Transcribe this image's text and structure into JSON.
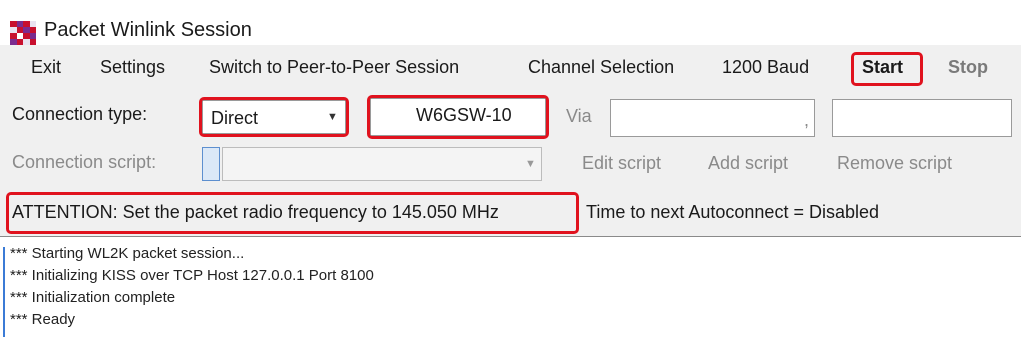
{
  "window": {
    "title": "Packet Winlink Session",
    "icon": "checkered-app-icon",
    "icon_colors": [
      "#c8102e",
      "#7b2c8f",
      "#e9e3f0",
      "#ffffff"
    ]
  },
  "menu": {
    "exit": "Exit",
    "settings": "Settings",
    "switch_session": "Switch to Peer-to-Peer Session",
    "channel_selection": "Channel Selection",
    "baud": "1200 Baud",
    "start": "Start",
    "stop": "Stop"
  },
  "connection": {
    "type_label": "Connection type:",
    "type_value": "Direct",
    "callsign": "W6GSW-10",
    "via_label": "Via",
    "via_value_1": "",
    "via_separator": ",",
    "via_value_2": ""
  },
  "script_row": {
    "label": "Connection script:",
    "value": "",
    "edit": "Edit script",
    "add": "Add script",
    "remove": "Remove script"
  },
  "status": {
    "attention": "ATTENTION: Set the packet radio frequency to 145.050 MHz",
    "autoconnect": "Time to next Autoconnect = Disabled"
  },
  "log": {
    "lines": [
      "*** Starting WL2K packet session...",
      "*** Initializing KISS over TCP Host 127.0.0.1 Port 8100",
      "*** Initialization complete",
      "*** Ready"
    ]
  },
  "highlight_color": "#e0121e"
}
